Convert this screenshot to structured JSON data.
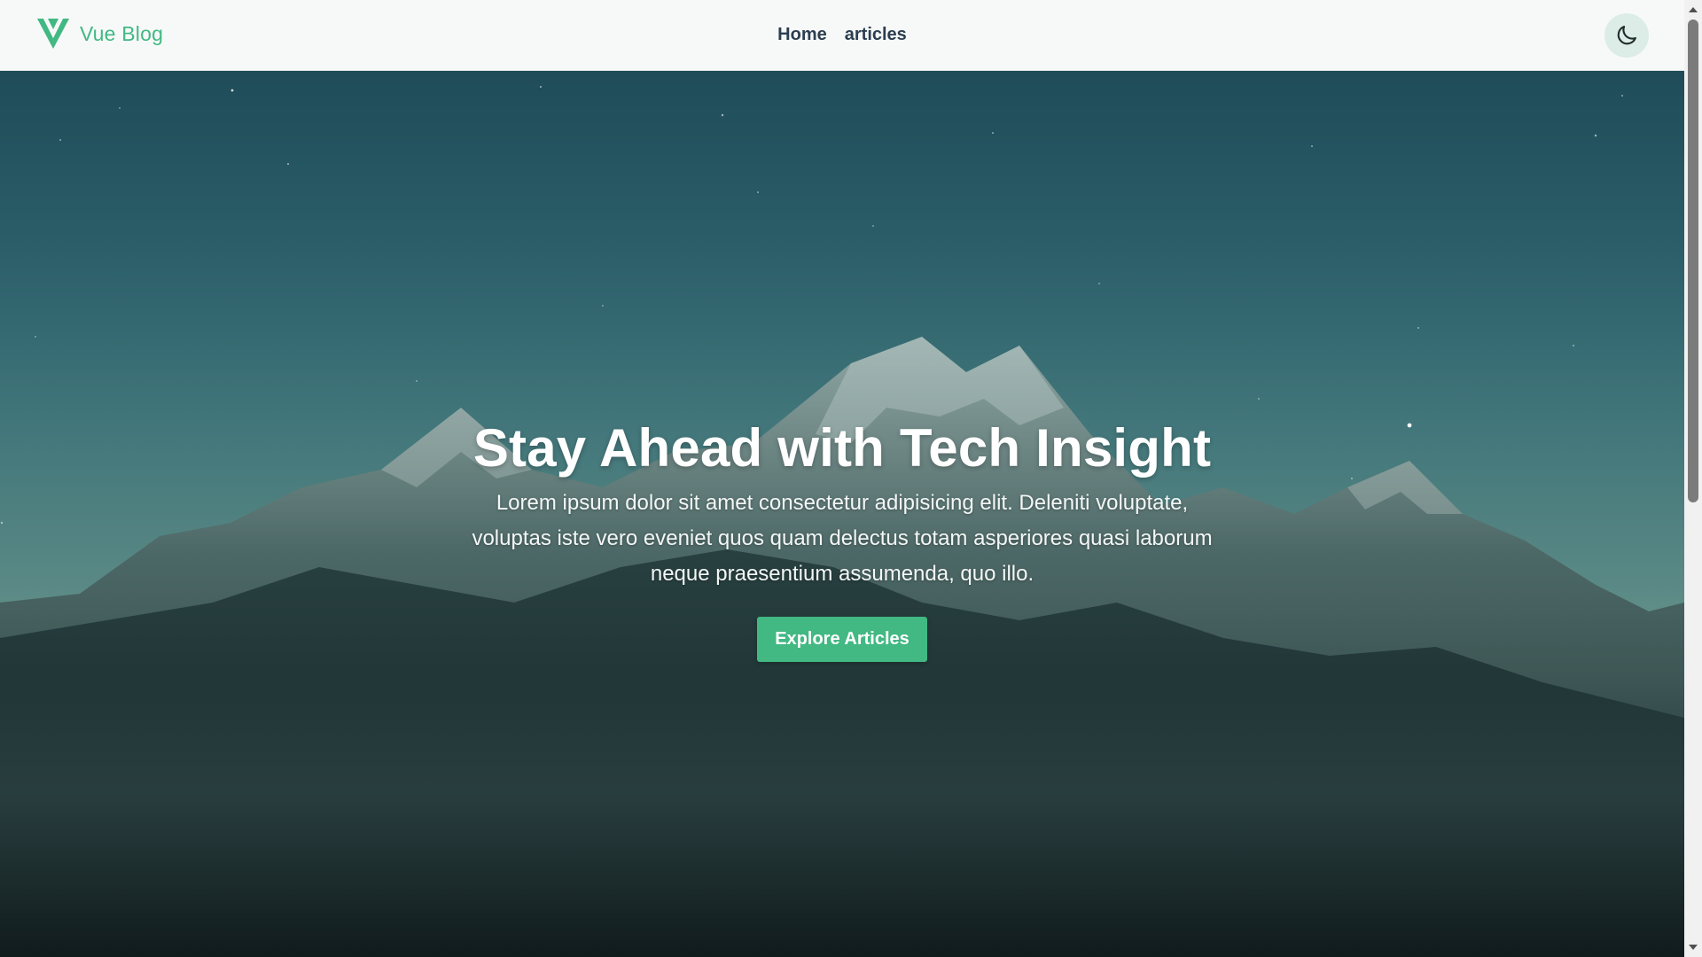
{
  "header": {
    "brand": "Vue Blog",
    "nav": [
      {
        "label": "Home"
      },
      {
        "label": "articles"
      }
    ],
    "theme_toggle_icon": "moon-icon"
  },
  "hero": {
    "title": "Stay Ahead with Tech Insight",
    "subtitle": "Lorem ipsum dolor sit amet consectetur adipisicing elit. Deleniti voluptate, voluptas iste vero eveniet quos quam delectus totam asperiores quasi laborum neque praesentium assumenda, quo illo.",
    "cta_label": "Explore Articles",
    "background": "night-mountain-photo"
  },
  "colors": {
    "accent": "#42b883",
    "nav_text": "#2c3e50",
    "header_bg": "#f7f9f8"
  },
  "icons": {
    "logo": "vue-logo-icon",
    "theme": "moon-icon"
  }
}
